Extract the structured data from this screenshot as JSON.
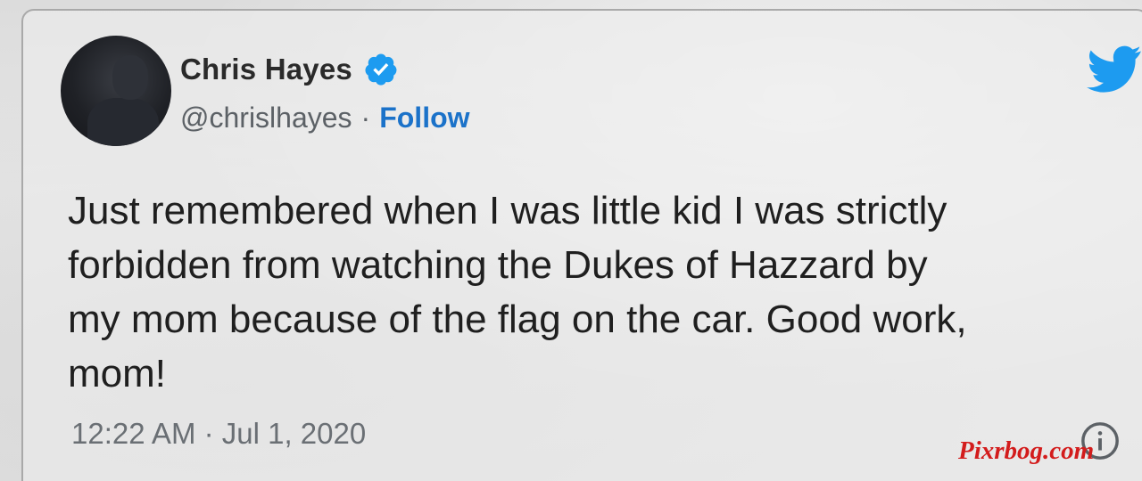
{
  "author": {
    "display_name": "Chris Hayes",
    "handle": "@chrislhayes",
    "separator": "·",
    "follow_label": "Follow",
    "verified": true,
    "verified_color": "#1d9bf0"
  },
  "brand": {
    "icon": "twitter-bird-icon",
    "color": "#1d9bf0"
  },
  "tweet": {
    "text": "Just remembered when I was little kid I was strictly\nforbidden from watching the Dukes of Hazzard by\nmy mom because of the flag on the car. Good work,\nmom!",
    "timestamp": "12:22 AM · Jul 1, 2020"
  },
  "footer": {
    "info_icon": "info-icon"
  },
  "watermark": {
    "text": "Pixrbog.com",
    "color": "#d31c1c"
  }
}
